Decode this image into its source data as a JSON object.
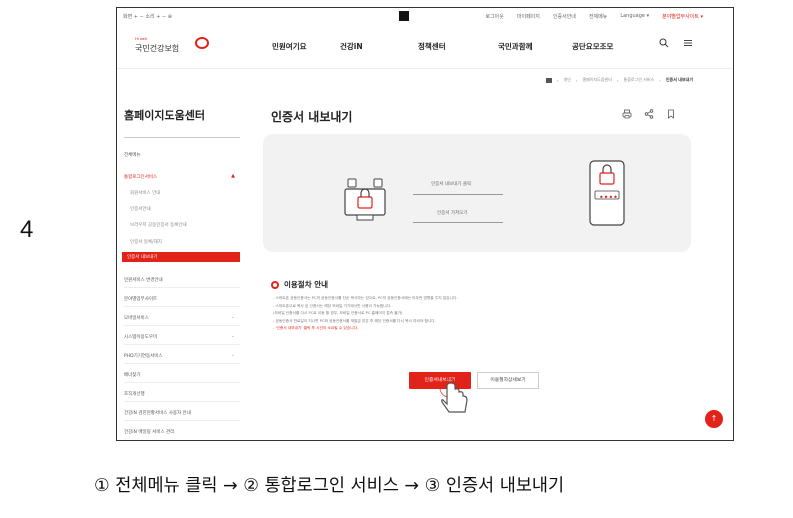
{
  "step_number": "4",
  "caption": "① 전체메뉴 클릭 → ② 통합로그인 서비스 → ③ 인증서 내보내기",
  "screenshot": {
    "util_bar": {
      "font_controls": "화면 + −  소리 + −  ⊕",
      "links": [
        "로그아웃",
        "마이페이지",
        "인증서안내",
        "전체메뉴",
        "Language ▾",
        "분야별업무사이트 ▾"
      ]
    },
    "logo": {
      "en": "Hi well",
      "ko": "국민건강보험"
    },
    "gnb": {
      "items": [
        "민원여기요",
        "건강iN",
        "정책센터",
        "국민과함께",
        "공단요모조모"
      ]
    },
    "breadcrumb": [
      "개인",
      "홈페이지도움센터",
      "통합로그인 서비스",
      "인증서 내보내기"
    ],
    "sidebar": {
      "title": "홈페이지도움센터",
      "items": [
        {
          "label": "전체메뉴",
          "type": "main"
        },
        {
          "label": "통합로그인서비스",
          "type": "main-open"
        },
        {
          "label": "회원서비스 안내",
          "type": "sub"
        },
        {
          "label": "인증서안내",
          "type": "sub"
        },
        {
          "label": "브라우저 공동인증서 등록안내",
          "type": "sub"
        },
        {
          "label": "인증서 등록/해지",
          "type": "sub"
        },
        {
          "label": "인증서 내보내기",
          "type": "active"
        },
        {
          "label": "민원서비스 변경안내",
          "type": "main"
        },
        {
          "label": "분야별업무사이트",
          "type": "main"
        },
        {
          "label": "모바일서비스",
          "type": "main"
        },
        {
          "label": "시스템이용도우미",
          "type": "main"
        },
        {
          "label": "PHD기기연동서비스",
          "type": "main"
        },
        {
          "label": "배너찾기",
          "type": "main"
        },
        {
          "label": "조직개선행",
          "type": "main"
        },
        {
          "label": "건강iN 검진현황서비스 사용자 안내",
          "type": "main"
        },
        {
          "label": "건강iN 메일링 서비스 관리",
          "type": "main"
        }
      ]
    },
    "page_title": "인증서 내보내기",
    "hero": {
      "label_top": "인증서 내보내기 클릭",
      "label_bottom": "인증서 가져오기",
      "pin_dots": "••••"
    },
    "notice": {
      "title": "이용절차 안내",
      "lines": [
        "- 스마트폰 공동인증서는 PC의 공동인증서를 단순 복사하는 것으로, PC의 공동인증서에는 아무런 영향을 주지 않습니다.",
        "- 스마트폰으로 복사 된 인증서는 해당 모바일 기기에서만 사용이 가능합니다.",
        "  (모바일 인증서를 다시 PC로 이동 할 경우, 모바일 인증서로 PC 홈페이지 접속 불가)",
        "- 공동인증서 만료일이 지나면 PC와 공동인증서를 재발급 받은 후 해당 인증서를 다시 복사 하셔야 합니다.",
        "- '인증서 내보내기' 클릭 후 시간이 소요될 수 있습니다."
      ]
    },
    "buttons": {
      "export": "인증서내보내기",
      "guide": "이용절차상세보기"
    },
    "top_button": "↑"
  }
}
